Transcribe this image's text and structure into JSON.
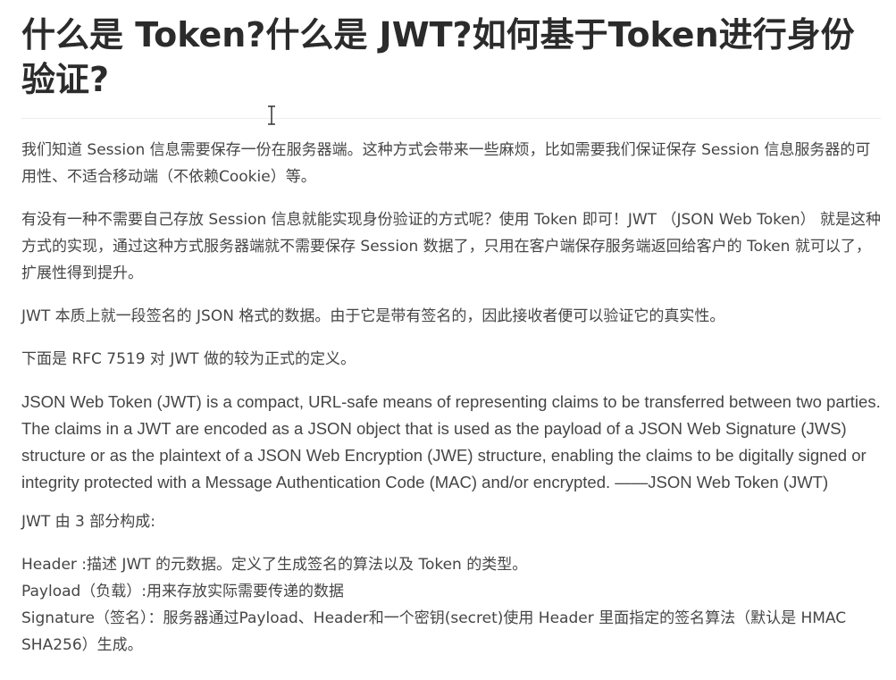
{
  "title": "什么是 Token?什么是 JWT?如何基于Token进行身份验证?",
  "paragraphs": [
    "我们知道 Session 信息需要保存一份在服务器端。这种方式会带来一些麻烦，比如需要我们保证保存 Session 信息服务器的可用性、不适合移动端（不依赖Cookie）等。",
    "有没有一种不需要自己存放 Session 信息就能实现身份验证的方式呢？使用 Token 即可！JWT （JSON Web Token） 就是这种方式的实现，通过这种方式服务器端就不需要保存 Session 数据了，只用在客户端保存服务端返回给客户的 Token 就可以了，扩展性得到提升。",
    "JWT 本质上就一段签名的 JSON 格式的数据。由于它是带有签名的，因此接收者便可以验证它的真实性。",
    "下面是 RFC 7519 对 JWT 做的较为正式的定义。"
  ],
  "quote": "JSON Web Token (JWT) is a compact, URL-safe means of representing claims to be transferred between two parties. The claims in a JWT are encoded as a JSON object that is used as the payload of a JSON Web Signature (JWS) structure or as the plaintext of a JSON Web Encryption (JWE) structure, enabling the claims to be digitally signed or integrity protected with a Message Authentication Code (MAC) and/or encrypted. ——JSON Web Token (JWT)",
  "parts_intro": "JWT 由 3 部分构成:",
  "parts": [
    "Header :描述 JWT 的元数据。定义了生成签名的算法以及 Token 的类型。",
    "Payload（负载）:用来存放实际需要传递的数据",
    "Signature（签名）：服务器通过Payload、Header和一个密钥(secret)使用 Header 里面指定的签名算法（默认是 HMAC SHA256）生成。"
  ],
  "cursor_icon": "text-cursor-icon"
}
